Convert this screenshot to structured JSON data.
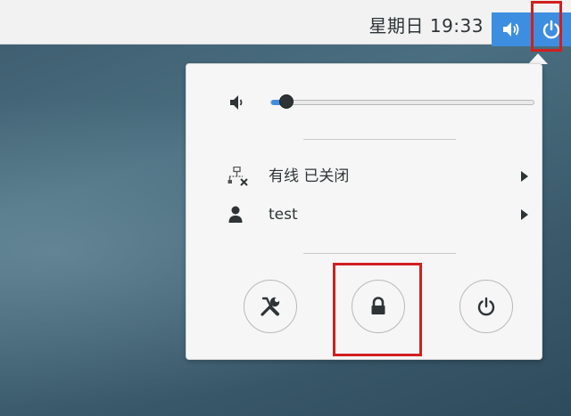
{
  "topbar": {
    "clock": "星期日 19:33"
  },
  "menu": {
    "volume": {
      "level": 0.06
    },
    "network": {
      "label": "有线 已关闭"
    },
    "user": {
      "label": "test"
    }
  },
  "colors": {
    "accent": "#3d8ee0",
    "highlight": "#d0201f",
    "menu_bg": "#f6f6f6",
    "text": "#2e3436"
  },
  "icons": {
    "tray": [
      "volume-icon",
      "power-icon"
    ],
    "rows": [
      "network-wired-off-icon",
      "user-icon"
    ],
    "actions": [
      "settings-icon",
      "lock-icon",
      "power-off-icon"
    ]
  }
}
